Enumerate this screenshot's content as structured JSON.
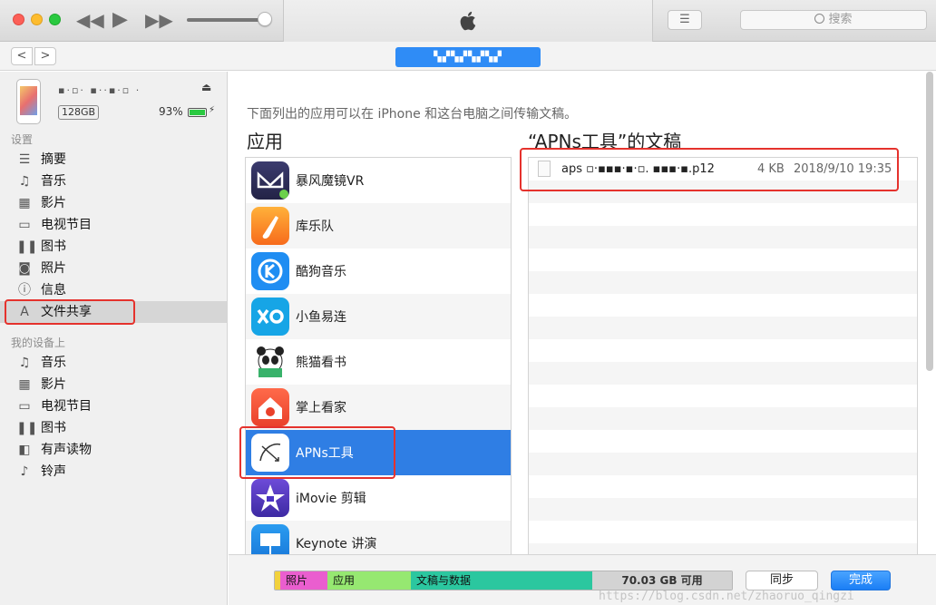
{
  "toolbar": {
    "search_placeholder": "搜索",
    "list_glyph": "☰",
    "rewind_glyph": "◀◀",
    "play_glyph": "▶",
    "forward_glyph": "▶▶",
    "volume_level": 0.9
  },
  "nav": {
    "back_glyph": "<",
    "forward_glyph": ">",
    "device_tab_label": "▚▞▚▞▚▞▚▞"
  },
  "device": {
    "name": "▪·▫·  ▪··▪·▫  ·",
    "capacity": "128GB",
    "battery_percent": "93%",
    "eject_glyph": "⏏",
    "charging_glyph": "⚡"
  },
  "sidebar": {
    "settings_header": "设置",
    "settings_items": [
      {
        "label": "摘要",
        "icon": "summary-icon",
        "glyph": "☰"
      },
      {
        "label": "音乐",
        "icon": "music-icon",
        "glyph": "♫"
      },
      {
        "label": "影片",
        "icon": "film-icon",
        "glyph": "▦"
      },
      {
        "label": "电视节目",
        "icon": "tv-icon",
        "glyph": "▭"
      },
      {
        "label": "图书",
        "icon": "book-icon",
        "glyph": "❚❚"
      },
      {
        "label": "照片",
        "icon": "camera-icon",
        "glyph": "◙"
      },
      {
        "label": "信息",
        "icon": "info-icon",
        "glyph": "ⓘ"
      },
      {
        "label": "文件共享",
        "icon": "apps-icon",
        "glyph": "A"
      }
    ],
    "my_device_header": "我的设备上",
    "device_items": [
      {
        "label": "音乐",
        "icon": "music-icon",
        "glyph": "♫"
      },
      {
        "label": "影片",
        "icon": "film-icon",
        "glyph": "▦"
      },
      {
        "label": "电视节目",
        "icon": "tv-icon",
        "glyph": "▭"
      },
      {
        "label": "图书",
        "icon": "book-icon",
        "glyph": "❚❚"
      },
      {
        "label": "有声读物",
        "icon": "audiobook-icon",
        "glyph": "◧"
      },
      {
        "label": "铃声",
        "icon": "bell-icon",
        "glyph": "♪"
      }
    ]
  },
  "main": {
    "description": "下面列出的应用可以在 iPhone 和这台电脑之间传输文稿。",
    "apps_title": "应用",
    "docs_title": "“APNs工具”的文稿",
    "apps": [
      {
        "label": "暴风魔镜VR",
        "icon": "baofeng-vr-icon"
      },
      {
        "label": "库乐队",
        "icon": "garageband-icon"
      },
      {
        "label": "酷狗音乐",
        "icon": "kugou-icon"
      },
      {
        "label": "小鱼易连",
        "icon": "xiaoyu-icon"
      },
      {
        "label": "熊猫看书",
        "icon": "panda-icon"
      },
      {
        "label": "掌上看家",
        "icon": "home-cam-icon"
      },
      {
        "label": "APNs工具",
        "icon": "apns-icon"
      },
      {
        "label": "iMovie 剪辑",
        "icon": "imovie-icon"
      },
      {
        "label": "Keynote 讲演",
        "icon": "keynote-icon"
      }
    ],
    "documents": [
      {
        "name": "aps ▫·▪▪▪·▪·▫. ▪▪▪·▪.p12",
        "size": "4 KB",
        "date": "2018/9/10 19:35"
      }
    ]
  },
  "storage": {
    "segments": [
      {
        "label": "照片",
        "color": "#ea5ecf"
      },
      {
        "label": "应用",
        "color": "#96e871"
      },
      {
        "label": "文稿与数据",
        "color": "#2bc79f"
      }
    ],
    "free_label": "70.03 GB 可用",
    "sync_label": "同步",
    "done_label": "完成"
  },
  "watermark": "https://blog.csdn.net/zhaoruo_qingzi",
  "colors": {
    "accent": "#2f7ee4",
    "highlight_box": "#e5322d"
  }
}
